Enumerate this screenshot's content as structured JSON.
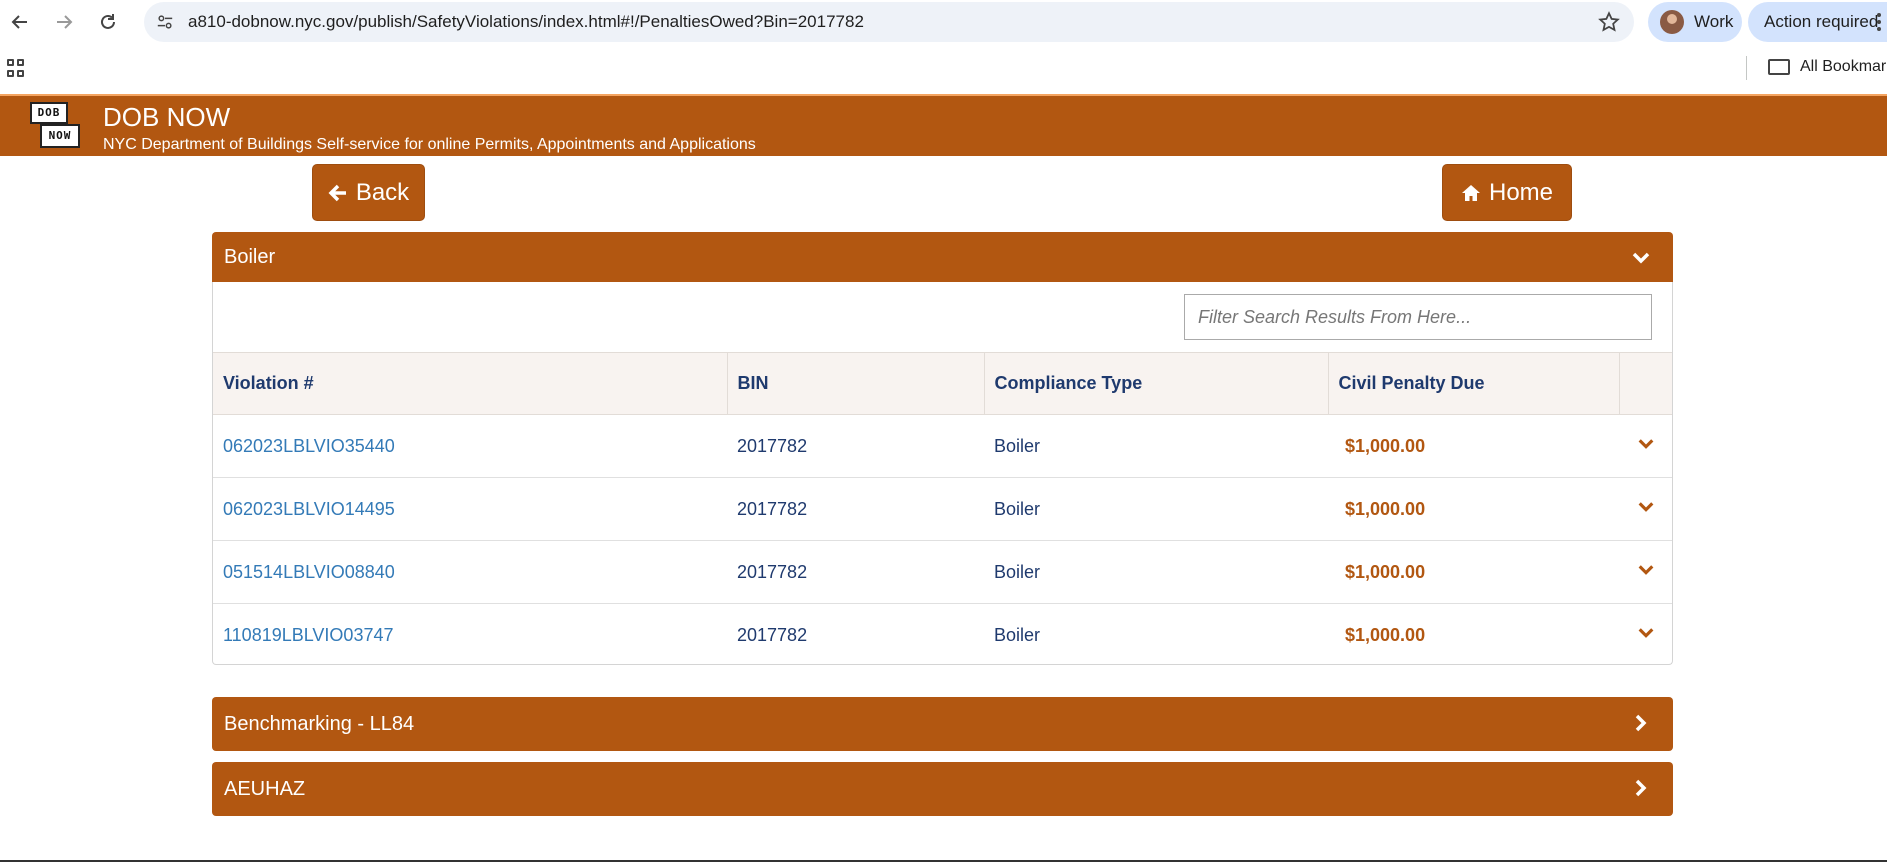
{
  "browser": {
    "url": "a810-dobnow.nyc.gov/publish/SafetyViolations/index.html#!/PenaltiesOwed?Bin=2017782",
    "profile_label": "Work",
    "action_label": "Action required",
    "all_bookmarks_label": "All Bookmarks"
  },
  "app": {
    "logo_top": "DOB",
    "logo_bottom": "NOW",
    "title": "DOB NOW",
    "subtitle": "NYC Department of Buildings Self-service for online Permits, Appointments and Applications",
    "accent_color": "#b25711"
  },
  "nav": {
    "back_label": "Back",
    "home_label": "Home"
  },
  "panels": {
    "boiler": {
      "title": "Boiler",
      "filter_placeholder": "Filter Search Results From Here...",
      "columns": [
        "Violation #",
        "BIN",
        "Compliance Type",
        "Civil Penalty Due"
      ],
      "rows": [
        {
          "violation": "062023LBLVIO35440",
          "bin": "2017782",
          "type": "Boiler",
          "penalty": "$1,000.00"
        },
        {
          "violation": "062023LBLVIO14495",
          "bin": "2017782",
          "type": "Boiler",
          "penalty": "$1,000.00"
        },
        {
          "violation": "051514LBLVIO08840",
          "bin": "2017782",
          "type": "Boiler",
          "penalty": "$1,000.00"
        },
        {
          "violation": "110819LBLVIO03747",
          "bin": "2017782",
          "type": "Boiler",
          "penalty": "$1,000.00"
        }
      ]
    },
    "benchmarking": {
      "title": "Benchmarking - LL84"
    },
    "aeuhaz": {
      "title": "AEUHAZ"
    }
  }
}
